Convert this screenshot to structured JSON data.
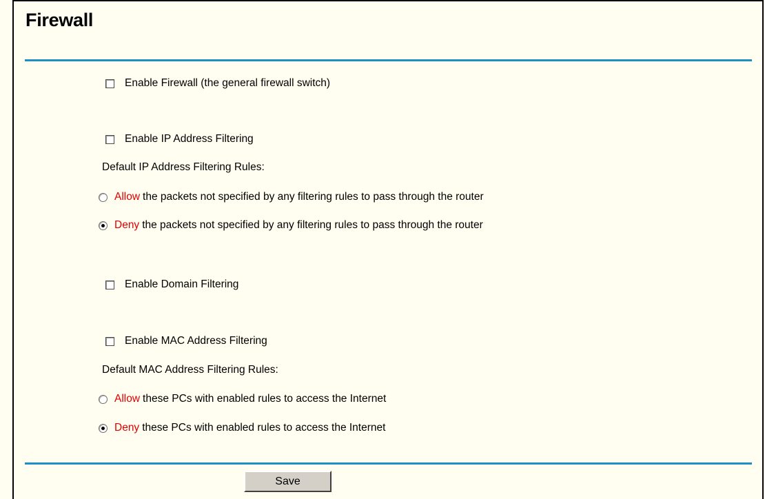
{
  "page": {
    "title": "Firewall"
  },
  "general": {
    "enable_firewall_label": "Enable Firewall (the general firewall switch)",
    "enable_firewall_checked": false
  },
  "ip_filtering": {
    "enable_label": "Enable IP Address Filtering",
    "enable_checked": false,
    "rules_heading": "Default IP Address Filtering Rules:",
    "options": [
      {
        "keyword": "Allow",
        "text": "the packets not specified by any filtering rules to pass through the router",
        "selected": false
      },
      {
        "keyword": "Deny",
        "text": "the packets not specified by any filtering rules to pass through the router",
        "selected": true
      }
    ]
  },
  "domain_filtering": {
    "enable_label": "Enable Domain Filtering",
    "enable_checked": false
  },
  "mac_filtering": {
    "enable_label": "Enable MAC Address Filtering",
    "enable_checked": false,
    "rules_heading": "Default MAC Address Filtering Rules:",
    "options": [
      {
        "keyword": "Allow",
        "text": "these PCs with enabled rules to access the Internet",
        "selected": false
      },
      {
        "keyword": "Deny",
        "text": "these PCs with enabled rules to access the Internet",
        "selected": true
      }
    ]
  },
  "actions": {
    "save_label": "Save"
  },
  "colors": {
    "accent_rule": "#1c8fc9",
    "keyword": "#e00000",
    "background": "#fffef0"
  }
}
